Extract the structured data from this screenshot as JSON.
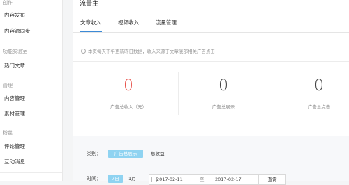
{
  "sidebar": {
    "sections": [
      {
        "title": "创作",
        "items": [
          "内容发布",
          "内容源同步"
        ]
      },
      {
        "title": "功能实验室",
        "items": [
          "热门文章"
        ]
      },
      {
        "title": "管理",
        "items": [
          "内容管理",
          "素材管理"
        ]
      },
      {
        "title": "粉丝",
        "items": [
          "评论管理",
          "互动消息"
        ]
      }
    ]
  },
  "main": {
    "title": "流量主",
    "tabs": [
      "文章收入",
      "视频收入",
      "流量管理"
    ],
    "notice": "本页每天下午更新昨日数据，收入来源于文章底部相关广告点击",
    "stats": [
      {
        "value": "0",
        "label": "广告总收入（元）"
      },
      {
        "value": "0",
        "label": "广告总展示"
      },
      {
        "value": "0",
        "label": "广告总点击"
      }
    ],
    "filter": {
      "category_label": "类别：",
      "category_active": "广告总展示",
      "category_other": "总收益",
      "time_label": "时间：",
      "range_active": "7日",
      "range_other": "1月",
      "start_date": "2017-02-11",
      "separator": "至",
      "end_date": "2017-02-17",
      "query_label": "查询"
    }
  },
  "colors": {
    "accent": "#3c8ad6",
    "highlight_zero": "#e8554e",
    "chip": "#8fd3f1"
  }
}
